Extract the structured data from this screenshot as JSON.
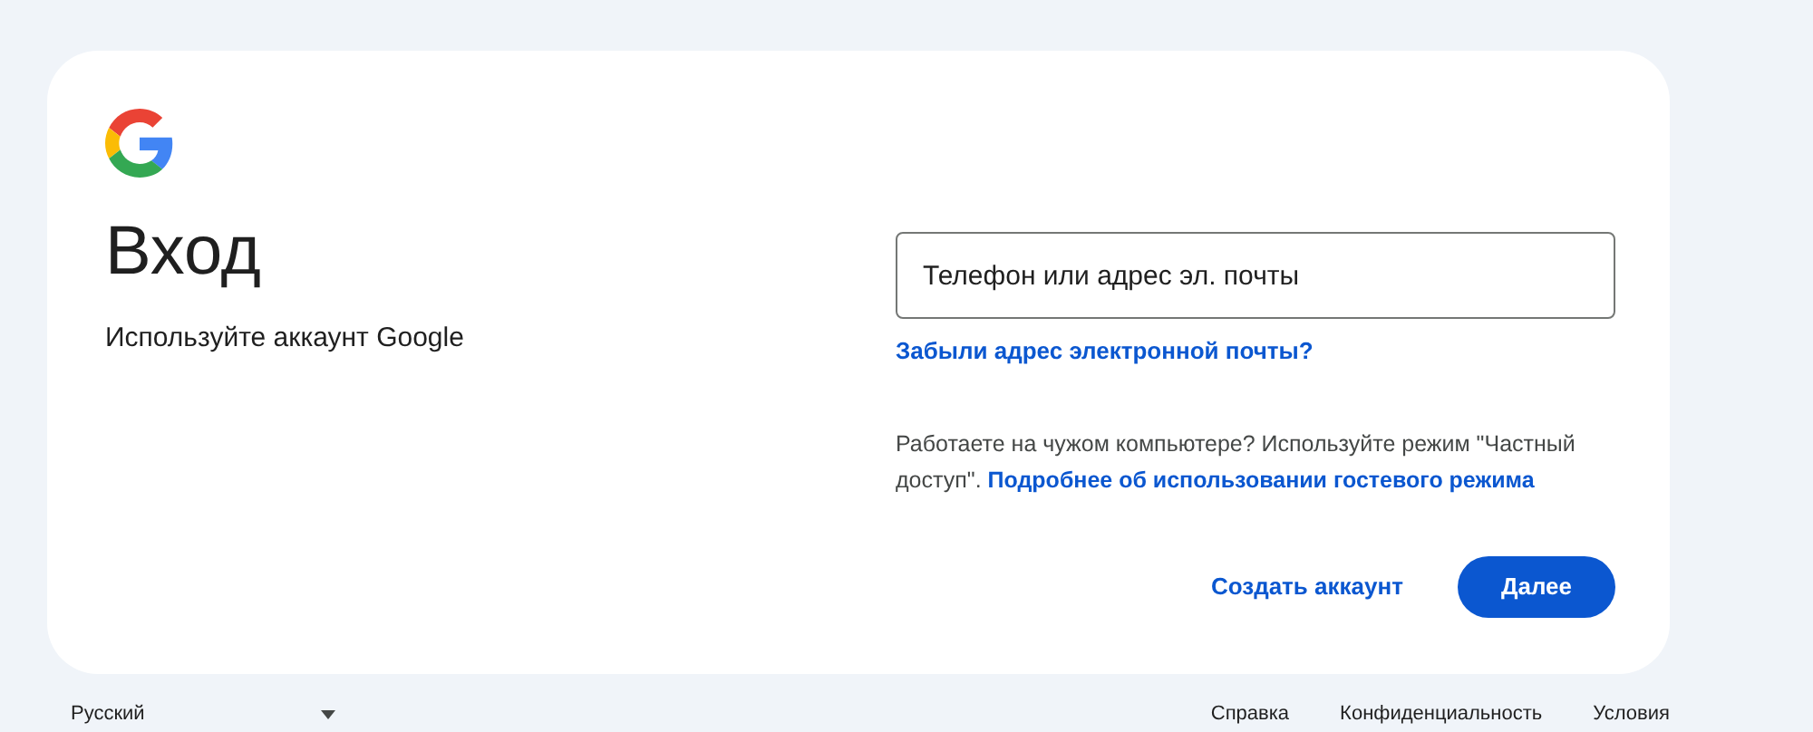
{
  "title": "Вход",
  "subtitle": "Используйте аккаунт Google",
  "email_field": {
    "placeholder": "Телефон или адрес эл. почты"
  },
  "forgot_link": "Забыли адрес электронной почты?",
  "guest_note": {
    "text": "Работаете на чужом компьютере? Используйте режим \"Частный доступ\".",
    "link": "Подробнее об использовании гостевого режима"
  },
  "buttons": [
    {
      "kind": "text",
      "label": "Создать аккаунт"
    },
    {
      "kind": "filled",
      "label": "Далее"
    }
  ],
  "footer": {
    "language": "Русский",
    "links": [
      "Справка",
      "Конфиденциальность",
      "Условия"
    ]
  }
}
